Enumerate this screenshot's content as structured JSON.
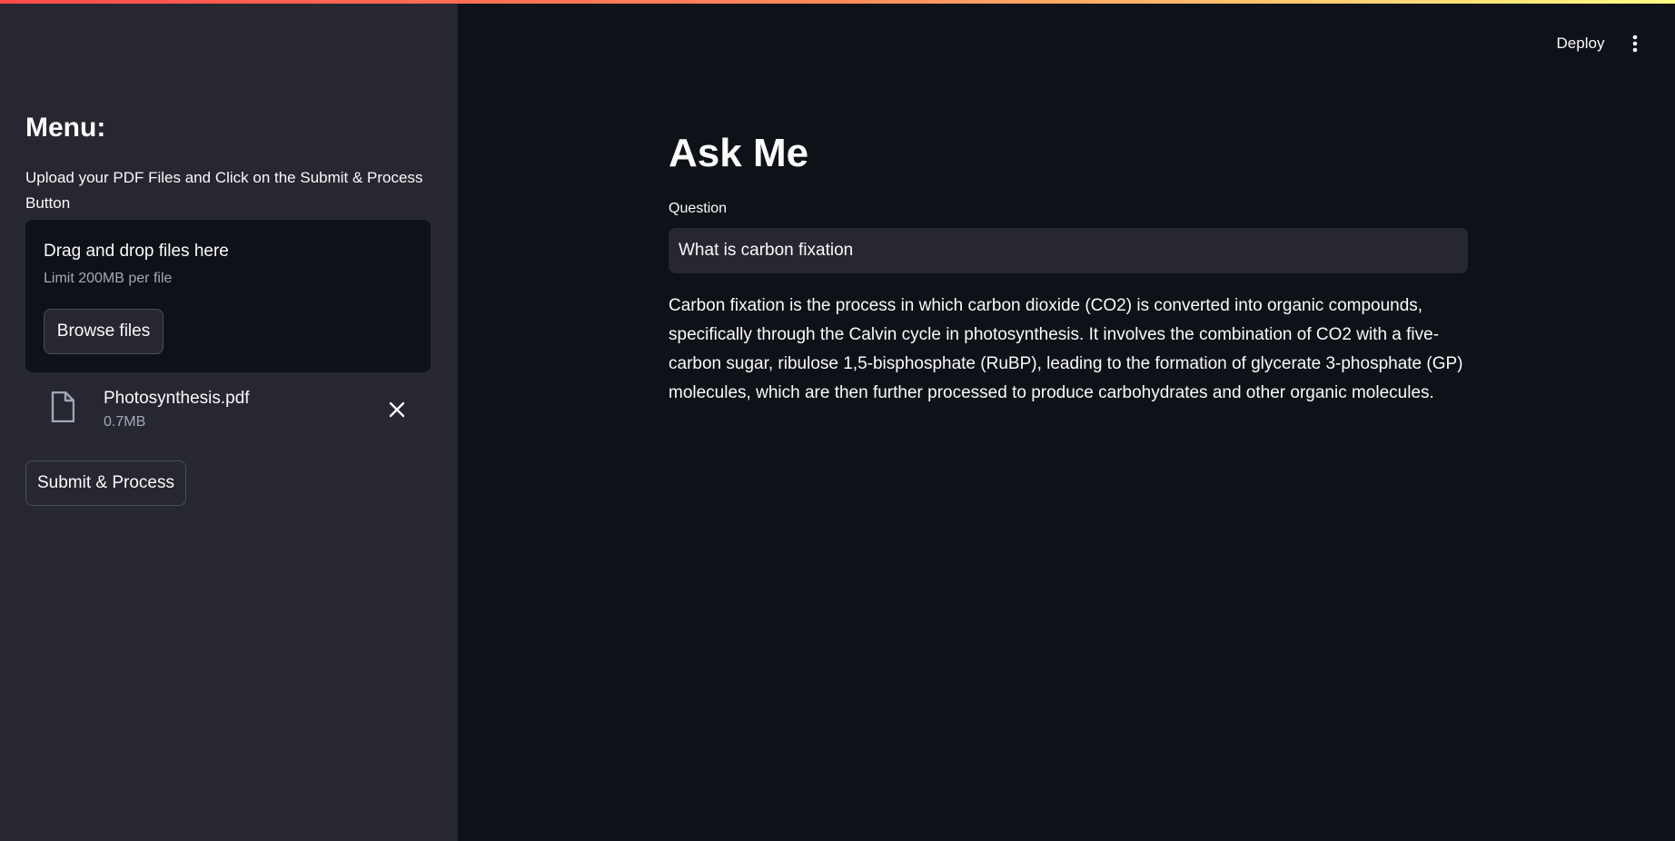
{
  "header": {
    "deploy_label": "Deploy",
    "menu_icon": "more-vertical-icon"
  },
  "sidebar": {
    "title": "Menu:",
    "description": "Upload your PDF Files and Click on the Submit & Process Button",
    "uploader": {
      "drop_text": "Drag and drop files here",
      "limit_text": "Limit 200MB per file",
      "browse_label": "Browse files"
    },
    "file": {
      "name": "Photosynthesis.pdf",
      "size": "0.7MB",
      "icon": "file-icon",
      "remove_icon": "close-icon"
    },
    "submit_label": "Submit & Process"
  },
  "main": {
    "title": "Ask Me",
    "question_label": "Question",
    "question_value": "What is carbon fixation",
    "answer": "Carbon fixation is the process in which carbon dioxide (CO2) is converted into organic compounds, specifically through the Calvin cycle in photosynthesis. It involves the combination of CO2 with a five-carbon sugar, ribulose 1,5-bisphosphate (RuBP), leading to the formation of glycerate 3-phosphate (GP) molecules, which are then further processed to produce carbohydrates and other organic molecules."
  },
  "colors": {
    "background": "#0e1117",
    "sidebar": "#262730",
    "accent_start": "#ff4b4b",
    "accent_end": "#fffd80",
    "text": "#fafafa",
    "muted_text": "#a3a8b8"
  }
}
